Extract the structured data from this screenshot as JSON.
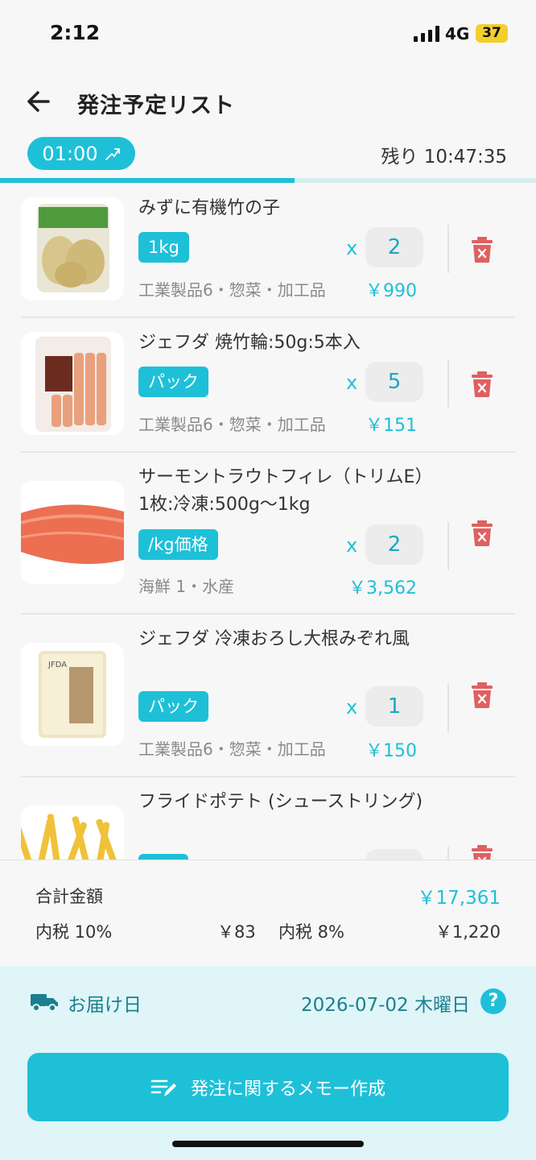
{
  "status": {
    "time": "2:12",
    "network": "4G",
    "battery": "37"
  },
  "header": {
    "title": "発注予定リスト"
  },
  "timer": {
    "label": "01:00",
    "remaining": "残り 10:47:35",
    "progress": 0.55
  },
  "items": [
    {
      "name": "みずに有機竹の子",
      "unit": "1kg",
      "x": "x",
      "qty": "2",
      "category": "工業製品6・惣菜・加工品",
      "price": "￥990"
    },
    {
      "name": "ジェフダ 焼竹輪:50g:5本入",
      "unit": "パック",
      "x": "x",
      "qty": "5",
      "category": "工業製品6・惣菜・加工品",
      "price": "￥151"
    },
    {
      "name": "サーモントラウトフィレ（トリムE）1枚:冷凍:500g～1kg",
      "unit": "/kg価格",
      "x": "x",
      "qty": "2",
      "category": "海鮮 1・水産",
      "price": "￥3,562"
    },
    {
      "name": "ジェフダ 冷凍おろし大根みぞれ風",
      "unit": "パック",
      "x": "x",
      "qty": "1",
      "category": "工業製品6・惣菜・加工品",
      "price": "￥150"
    },
    {
      "name": "フライドポテト (シューストリング)"
    }
  ],
  "summary": {
    "total_label": "合計金額",
    "total": "￥17,361",
    "tax10_label": "内税 10%",
    "tax10": "￥83",
    "tax8_label": "内税 8%",
    "tax8": "￥1,220"
  },
  "delivery": {
    "label": "お届け日",
    "date": "2026-07-02 木曜日",
    "help": "?"
  },
  "memo_button": {
    "label": "発注に関するメモー作成"
  },
  "icons": {
    "back": "arrow-left-icon",
    "trash": "trash-icon",
    "truck": "delivery-truck-icon",
    "memo": "edit-note-icon",
    "timer": "trend-icon"
  },
  "colors": {
    "accent": "#1ec0d8",
    "delete": "#e06060",
    "delivery_bg": "#dff5f8"
  }
}
